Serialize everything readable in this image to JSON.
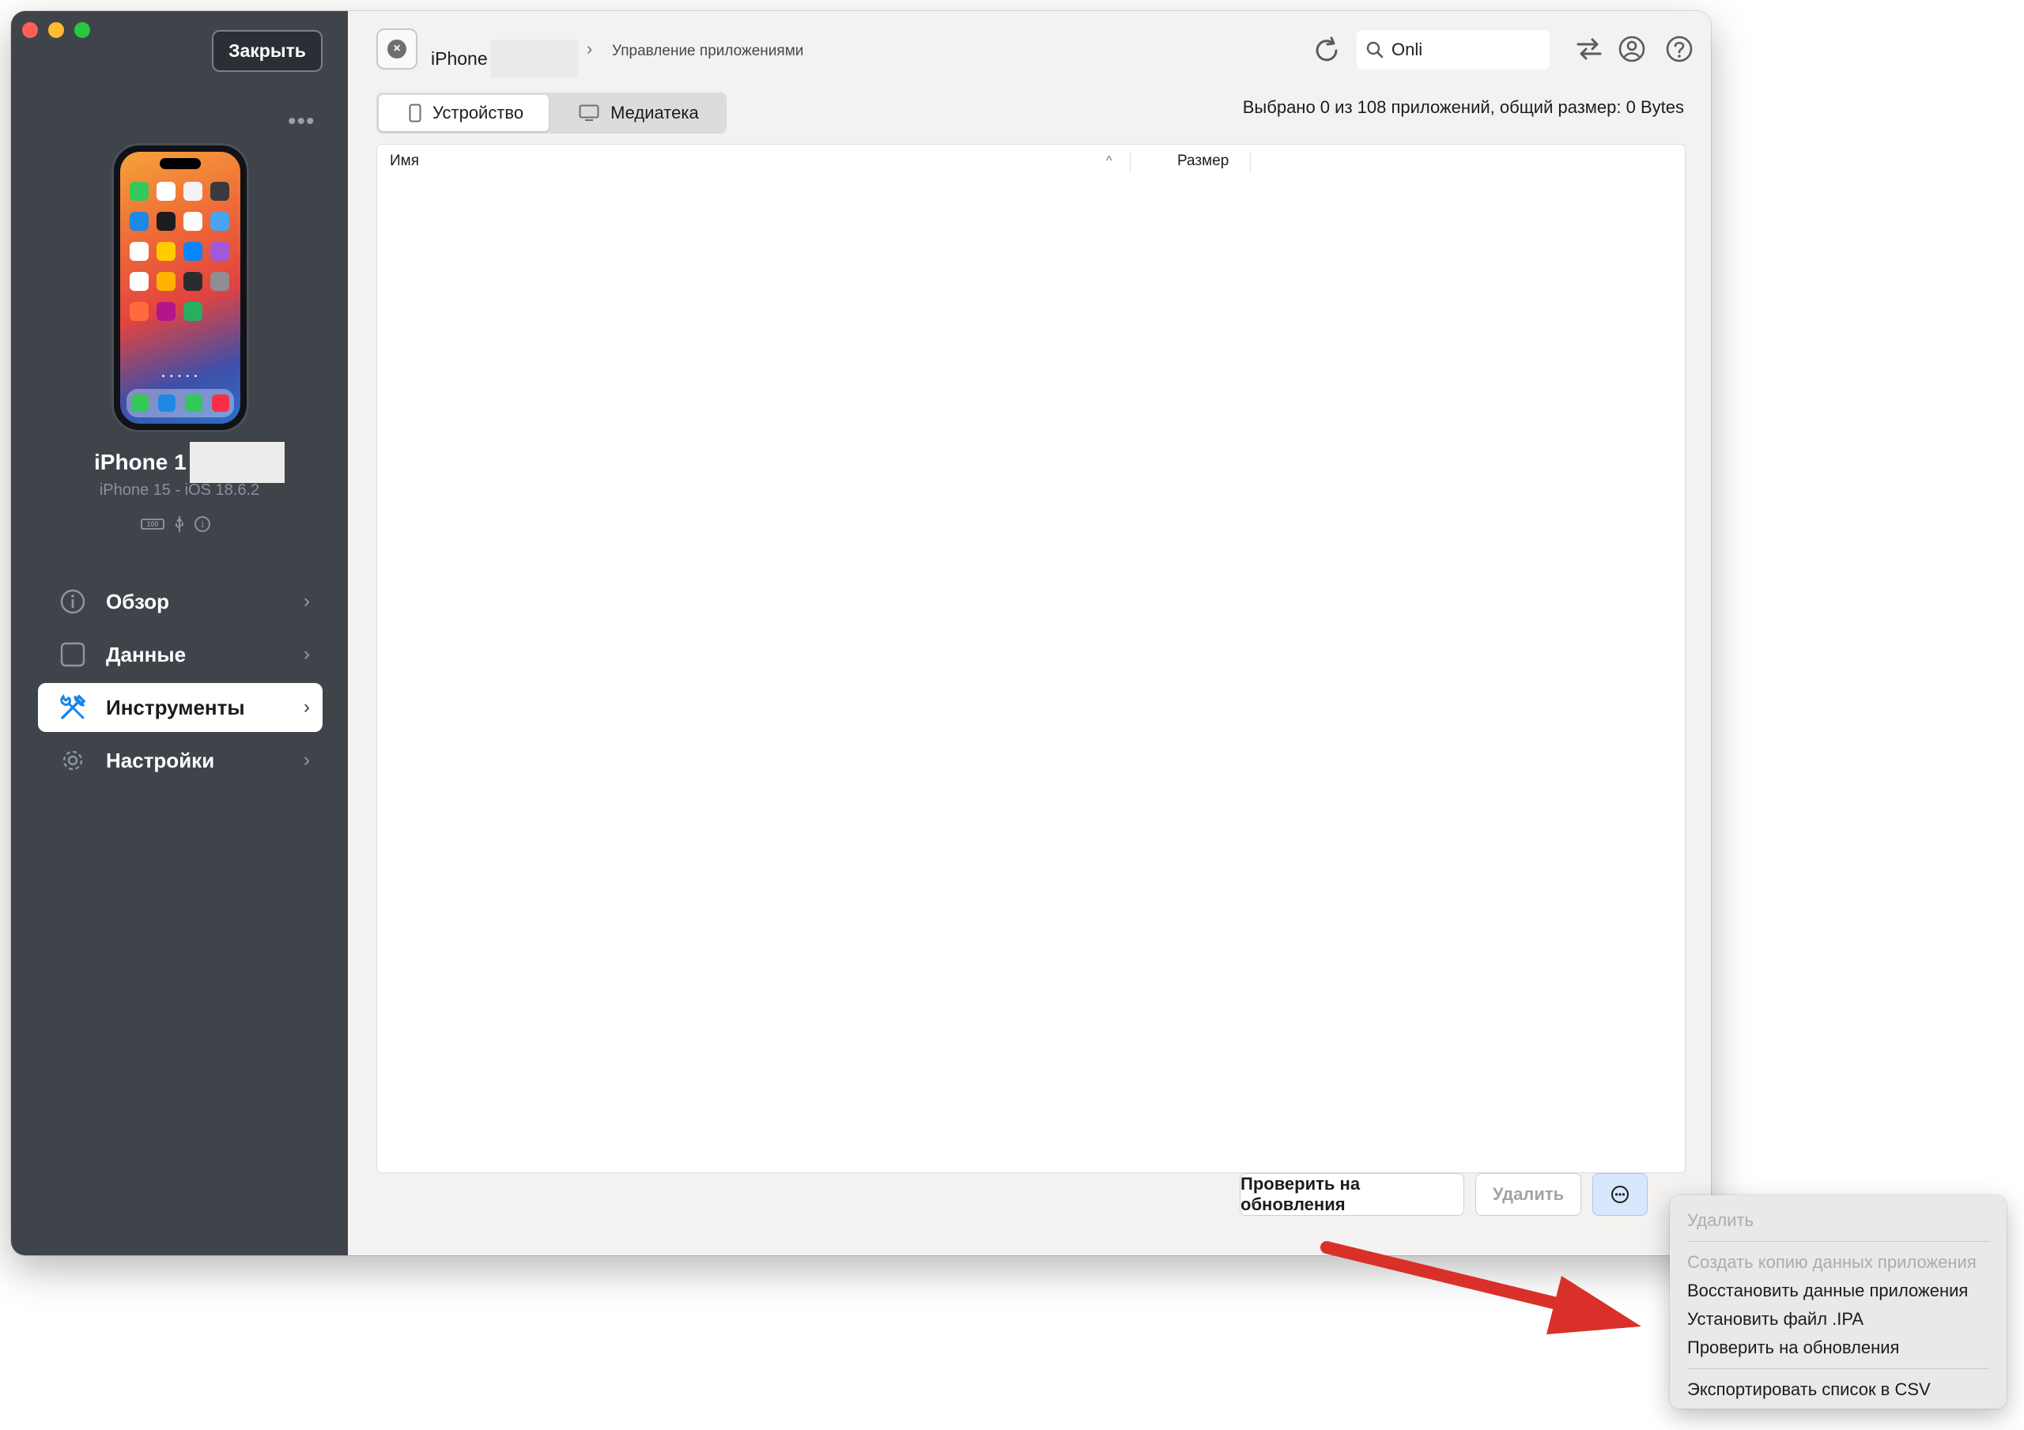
{
  "sidebar": {
    "close_label": "Закрыть",
    "more_label": "•••",
    "device": {
      "name": "iPhone 1",
      "model": "iPhone 15 - iOS 18.6.2",
      "battery_label": "100"
    },
    "items": [
      {
        "label": "Обзор",
        "icon": "info-icon"
      },
      {
        "label": "Данные",
        "icon": "square-icon"
      },
      {
        "label": "Инструменты",
        "icon": "tools-icon",
        "active": true
      },
      {
        "label": "Настройки",
        "icon": "gear-icon"
      }
    ]
  },
  "header": {
    "device_crumb": "iPhone",
    "separator": "›",
    "page_crumb": "Управление приложениями",
    "search": {
      "value": "Onli",
      "placeholder": ""
    }
  },
  "tabs": [
    {
      "label": "Устройство",
      "selected": true
    },
    {
      "label": "Медиатека",
      "selected": false
    }
  ],
  "status_text": "Выбрано 0 из 108 приложений, общий размер: 0 Bytes",
  "table": {
    "columns": [
      "Имя",
      "Размер"
    ],
    "sort_indicator": "^",
    "rows": []
  },
  "footer": {
    "check_updates_label": "Проверить на обновления",
    "delete_label": "Удалить"
  },
  "context_menu": {
    "items": [
      {
        "label": "Удалить",
        "disabled": true
      },
      {
        "label": "Создать копию данных приложения",
        "disabled": true
      },
      {
        "label": "Восстановить данные приложения",
        "disabled": false
      },
      {
        "label": "Установить файл .IPA",
        "disabled": false
      },
      {
        "label": "Проверить на обновления",
        "disabled": false
      },
      {
        "label": "Экспортировать список в CSV",
        "disabled": false
      }
    ]
  },
  "colors": {
    "sidebar_bg": "#3f444b",
    "accent": "#1a84e8",
    "annotation_arrow": "#d9302a"
  }
}
